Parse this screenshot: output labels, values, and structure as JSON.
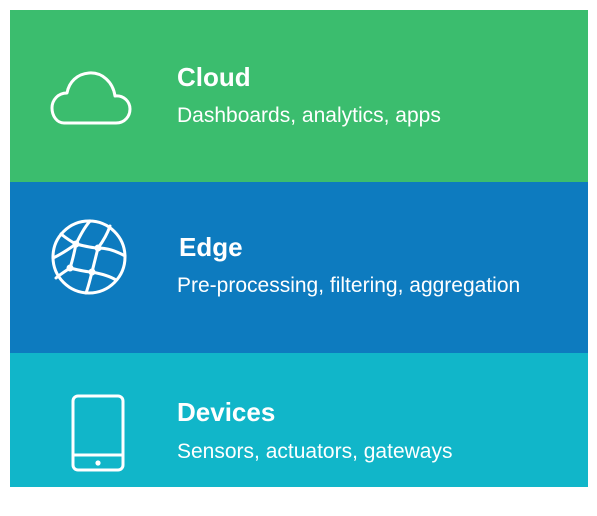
{
  "layers": [
    {
      "id": "cloud",
      "title": "Cloud",
      "subtitle": "Dashboards, analytics, apps",
      "icon": "cloud-icon",
      "color": "#3bbd6e"
    },
    {
      "id": "edge",
      "title": "Edge",
      "subtitle": "Pre-processing, filtering, aggregation",
      "icon": "network-globe-icon",
      "color": "#0d7bbf"
    },
    {
      "id": "devices",
      "title": "Devices",
      "subtitle": "Sensors, actuators, gateways",
      "icon": "mobile-device-icon",
      "color": "#11b6c9"
    }
  ]
}
